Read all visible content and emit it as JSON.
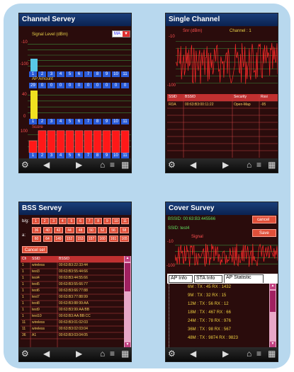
{
  "s1": {
    "title": "Channel Servey",
    "signal_label": "Signal Level (dBm)",
    "dropdown": "MA",
    "axis_neg10": "-10",
    "axis_neg100": "-100",
    "ap_label": "AP Amount",
    "ap_counts": [
      "29",
      "0",
      "0",
      "0",
      "0",
      "0",
      "0",
      "0",
      "0",
      "0",
      "0"
    ],
    "axis40": "40",
    "axis0": "0",
    "score_label": "Score",
    "axis100": "100",
    "channels": [
      "1",
      "2",
      "3",
      "4",
      "5",
      "6",
      "7",
      "8",
      "9",
      "10",
      "11"
    ],
    "score_values": [
      30,
      55,
      55,
      55,
      55,
      55,
      55,
      55,
      55,
      55,
      55
    ]
  },
  "s2": {
    "title": "Single Channel",
    "graph_label": "Snr (dBm)",
    "channel_label": "Channel : 1",
    "top_axis": "-10",
    "bottom_axis": "-100",
    "headers": [
      "SSID",
      "BSSID",
      "Security",
      "Rssi"
    ],
    "rows": [
      [
        "RDA",
        "00:63:B3:00:11:22",
        "Open-Map",
        "-95"
      ]
    ]
  },
  "s3": {
    "title": "BSS Servey",
    "row_label": "b/g:",
    "bg_channels": [
      "1",
      "2",
      "3",
      "4",
      "5",
      "6",
      "7",
      "8",
      "9",
      "10",
      "11"
    ],
    "a_label": "a:",
    "a_row1": [
      "36",
      "40",
      "42",
      "44",
      "48",
      "50",
      "52",
      "56",
      "58"
    ],
    "a_row2": [
      "60",
      "64",
      "149",
      "152",
      "153",
      "157",
      "160",
      "161",
      "165"
    ],
    "cancel_label": "Cancel sel",
    "headers": [
      "Ch",
      "SSID",
      "BSSID"
    ],
    "rows": [
      [
        "1",
        "wireless",
        "00:63:B3:22:33:44"
      ],
      [
        "1",
        "test3",
        "00:63:B3:55:44:66"
      ],
      [
        "1",
        "test4",
        "00:63:B3:44:55:66"
      ],
      [
        "1",
        "test5",
        "00:63:B3:55:66:77"
      ],
      [
        "1",
        "test6",
        "00:63:B3:66:77:88"
      ],
      [
        "1",
        "test7",
        "00:63:B3:77:88:99"
      ],
      [
        "1",
        "test8",
        "00:63:B3:88:99:AA"
      ],
      [
        "1",
        "test9",
        "00:63:B3:99:AA:BB"
      ],
      [
        "1",
        "test10",
        "00:63:B3:AA:BB:CC"
      ],
      [
        "11",
        "wireless",
        "00:63:B3:01:02:03"
      ],
      [
        "11",
        "wireless",
        "00:63:B3:02:03:04"
      ],
      [
        "36",
        "A1",
        "00:63:B3:03:04:05"
      ]
    ]
  },
  "s4": {
    "title": "Cover Survey",
    "bssid_line": "BSSID: 00:63:B3:445566",
    "ssid_line": "SSID: test4",
    "signal_label": "Signal",
    "cancel_button": "cancel",
    "save_button": "Save",
    "axis_top": "-10",
    "axis_bottom": "-100",
    "tabs": [
      "AP Info",
      "STA Info",
      "AP Statistic"
    ],
    "stats": [
      "6M : TX : 45 RX : 1432",
      "9M : TX : 32 RX : 15",
      "12M : TX : 56 RX : 12",
      "18M : TX : 467 RX : 66",
      "24M : TX : 78 RX : 976",
      "36M : TX : 98 RX : 567",
      "48M : TX : 9874 RX : 9823"
    ]
  }
}
